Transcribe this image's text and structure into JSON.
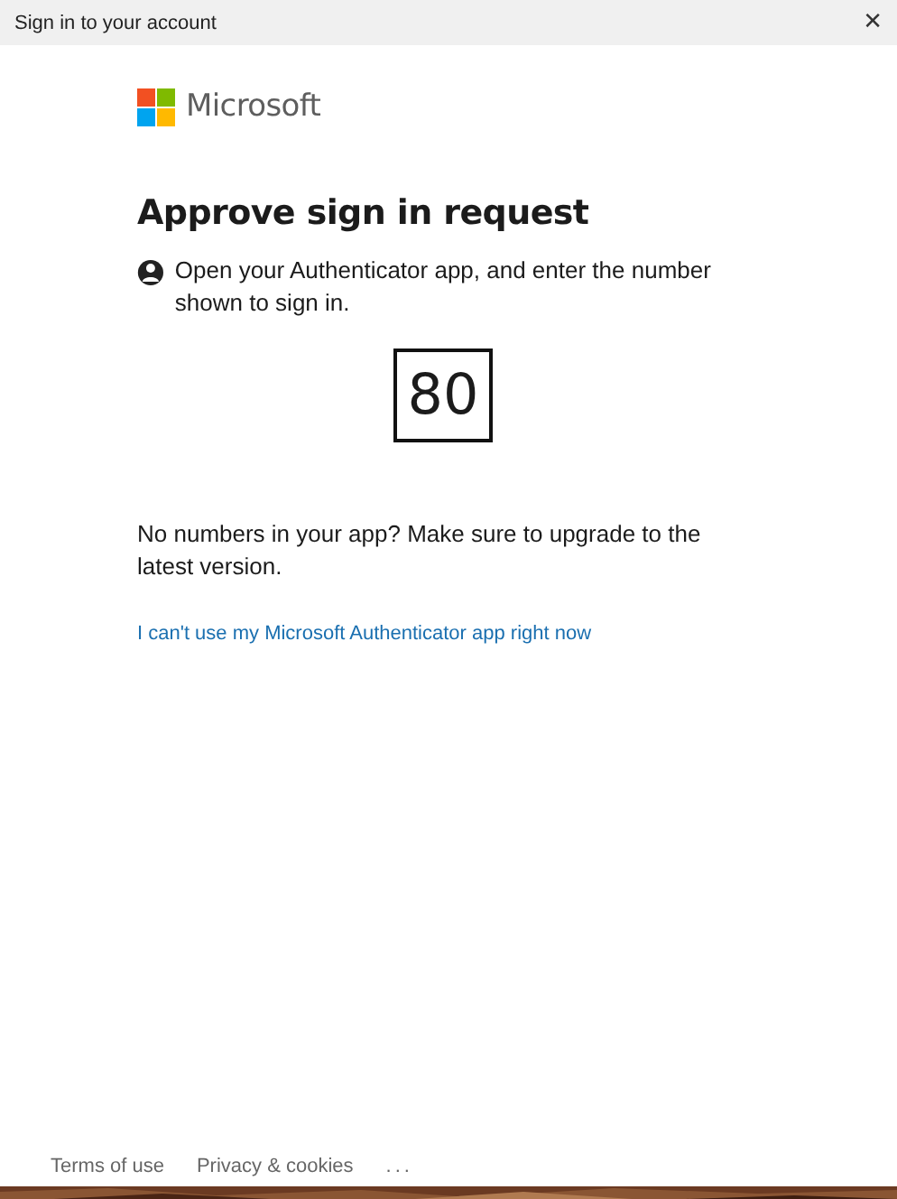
{
  "window": {
    "title": "Sign in to your account",
    "close": "✕"
  },
  "logo": {
    "text": "Microsoft"
  },
  "heading": "Approve sign in request",
  "instruction": "Open your Authenticator app, and enter the number shown to sign in.",
  "number": "80",
  "note": "No numbers in your app? Make sure to upgrade to the latest version.",
  "link": "I can't use my Microsoft Authenticator app right now",
  "footer": [
    "Terms of use",
    "Privacy & cookies",
    "..."
  ]
}
